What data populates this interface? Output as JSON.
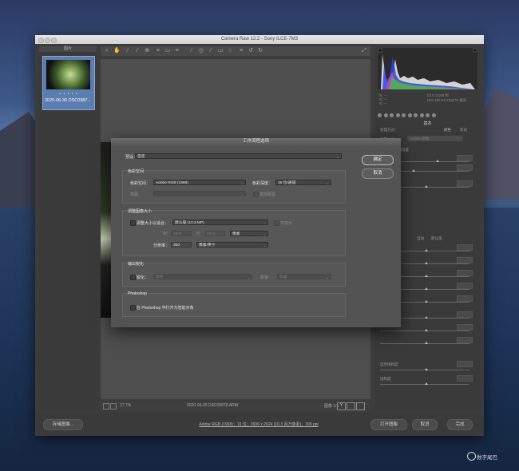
{
  "window": {
    "title": "Camera Raw 12.2 - Sony ILCE-7M3",
    "filmstrip_header": "图片",
    "thumbnail": {
      "stars": "• • • • •",
      "filename": "2020-06-30 DSC0987..."
    },
    "toolbar_icons": [
      "zoom-icon",
      "hand-icon",
      "white-balance-icon",
      "color-sampler-icon",
      "target-adjust-icon",
      "crop-icon",
      "straighten-icon",
      "transform-icon",
      "spot-removal-icon",
      "red-eye-icon",
      "adjustment-brush-icon",
      "graduated-filter-icon",
      "radial-filter-icon",
      "preferences-icon",
      "rotate-ccw-icon",
      "rotate-cw-icon"
    ],
    "status": {
      "zoom": "17.7%",
      "filename": "2020-06-30 DSC09878.ARW",
      "page": "图像 1/1"
    },
    "bottom": {
      "save_label": "存储图像...",
      "workflow_link": "Adobe RGB (1998)；16 位；3936 x 2624 (10.3 百万像素)；300 ppi",
      "open_label": "打开图像",
      "cancel_label": "取消",
      "done_label": "完成"
    }
  },
  "right_panel": {
    "info_rgb": [
      "R:  ---",
      "G:  ---",
      "B:  ---"
    ],
    "exif": [
      "f/3.5   1/160 秒",
      "ISO 160   24-70@75 毫米"
    ],
    "panel_title": "基本",
    "process_label": "处理方式：",
    "color_option": "颜色",
    "bw_option": "黑白",
    "profile_label": "配置文件：",
    "profile_value": "Adobe 颜色",
    "white_balance": "白平衡：原照设置",
    "auto": "自动",
    "default": "默认值",
    "vibrance": "自然饱和度",
    "saturation": "饱和度"
  },
  "dialog": {
    "title": "工作流程选项",
    "preset_label": "预设：",
    "preset_value": "自定",
    "ok_label": "确定",
    "cancel_label": "取消",
    "colorspace": {
      "caption": "色彩空间",
      "space_label": "色彩空间：",
      "space_value": "Adobe RGB (1998)",
      "depth_label": "色彩深度：",
      "depth_value": "16 位/通道",
      "intent_label": "意图：",
      "simulate_label": "模拟纸墨"
    },
    "resize": {
      "caption": "调整图像大小",
      "fit_label": "调整大小以适合：",
      "fit_value": "默认值 (10.3 MP)",
      "no_enlarge_label": "不放大",
      "w_label": "W:",
      "w_value": "3936",
      "h_label": "H:",
      "h_value": "2624",
      "unit_value": "像素",
      "res_label": "分辨率：",
      "res_value": "300",
      "res_unit_value": "像素/英寸"
    },
    "sharpen": {
      "caption": "输出锐化",
      "sharpen_label": "锐化：",
      "sharpen_value": "滤色",
      "amount_label": "数量：",
      "amount_value": "标准"
    },
    "photoshop": {
      "caption": "Photoshop",
      "smart_label": "在 Photoshop 中打开为智能对象"
    }
  },
  "watermark": "数字尾巴"
}
